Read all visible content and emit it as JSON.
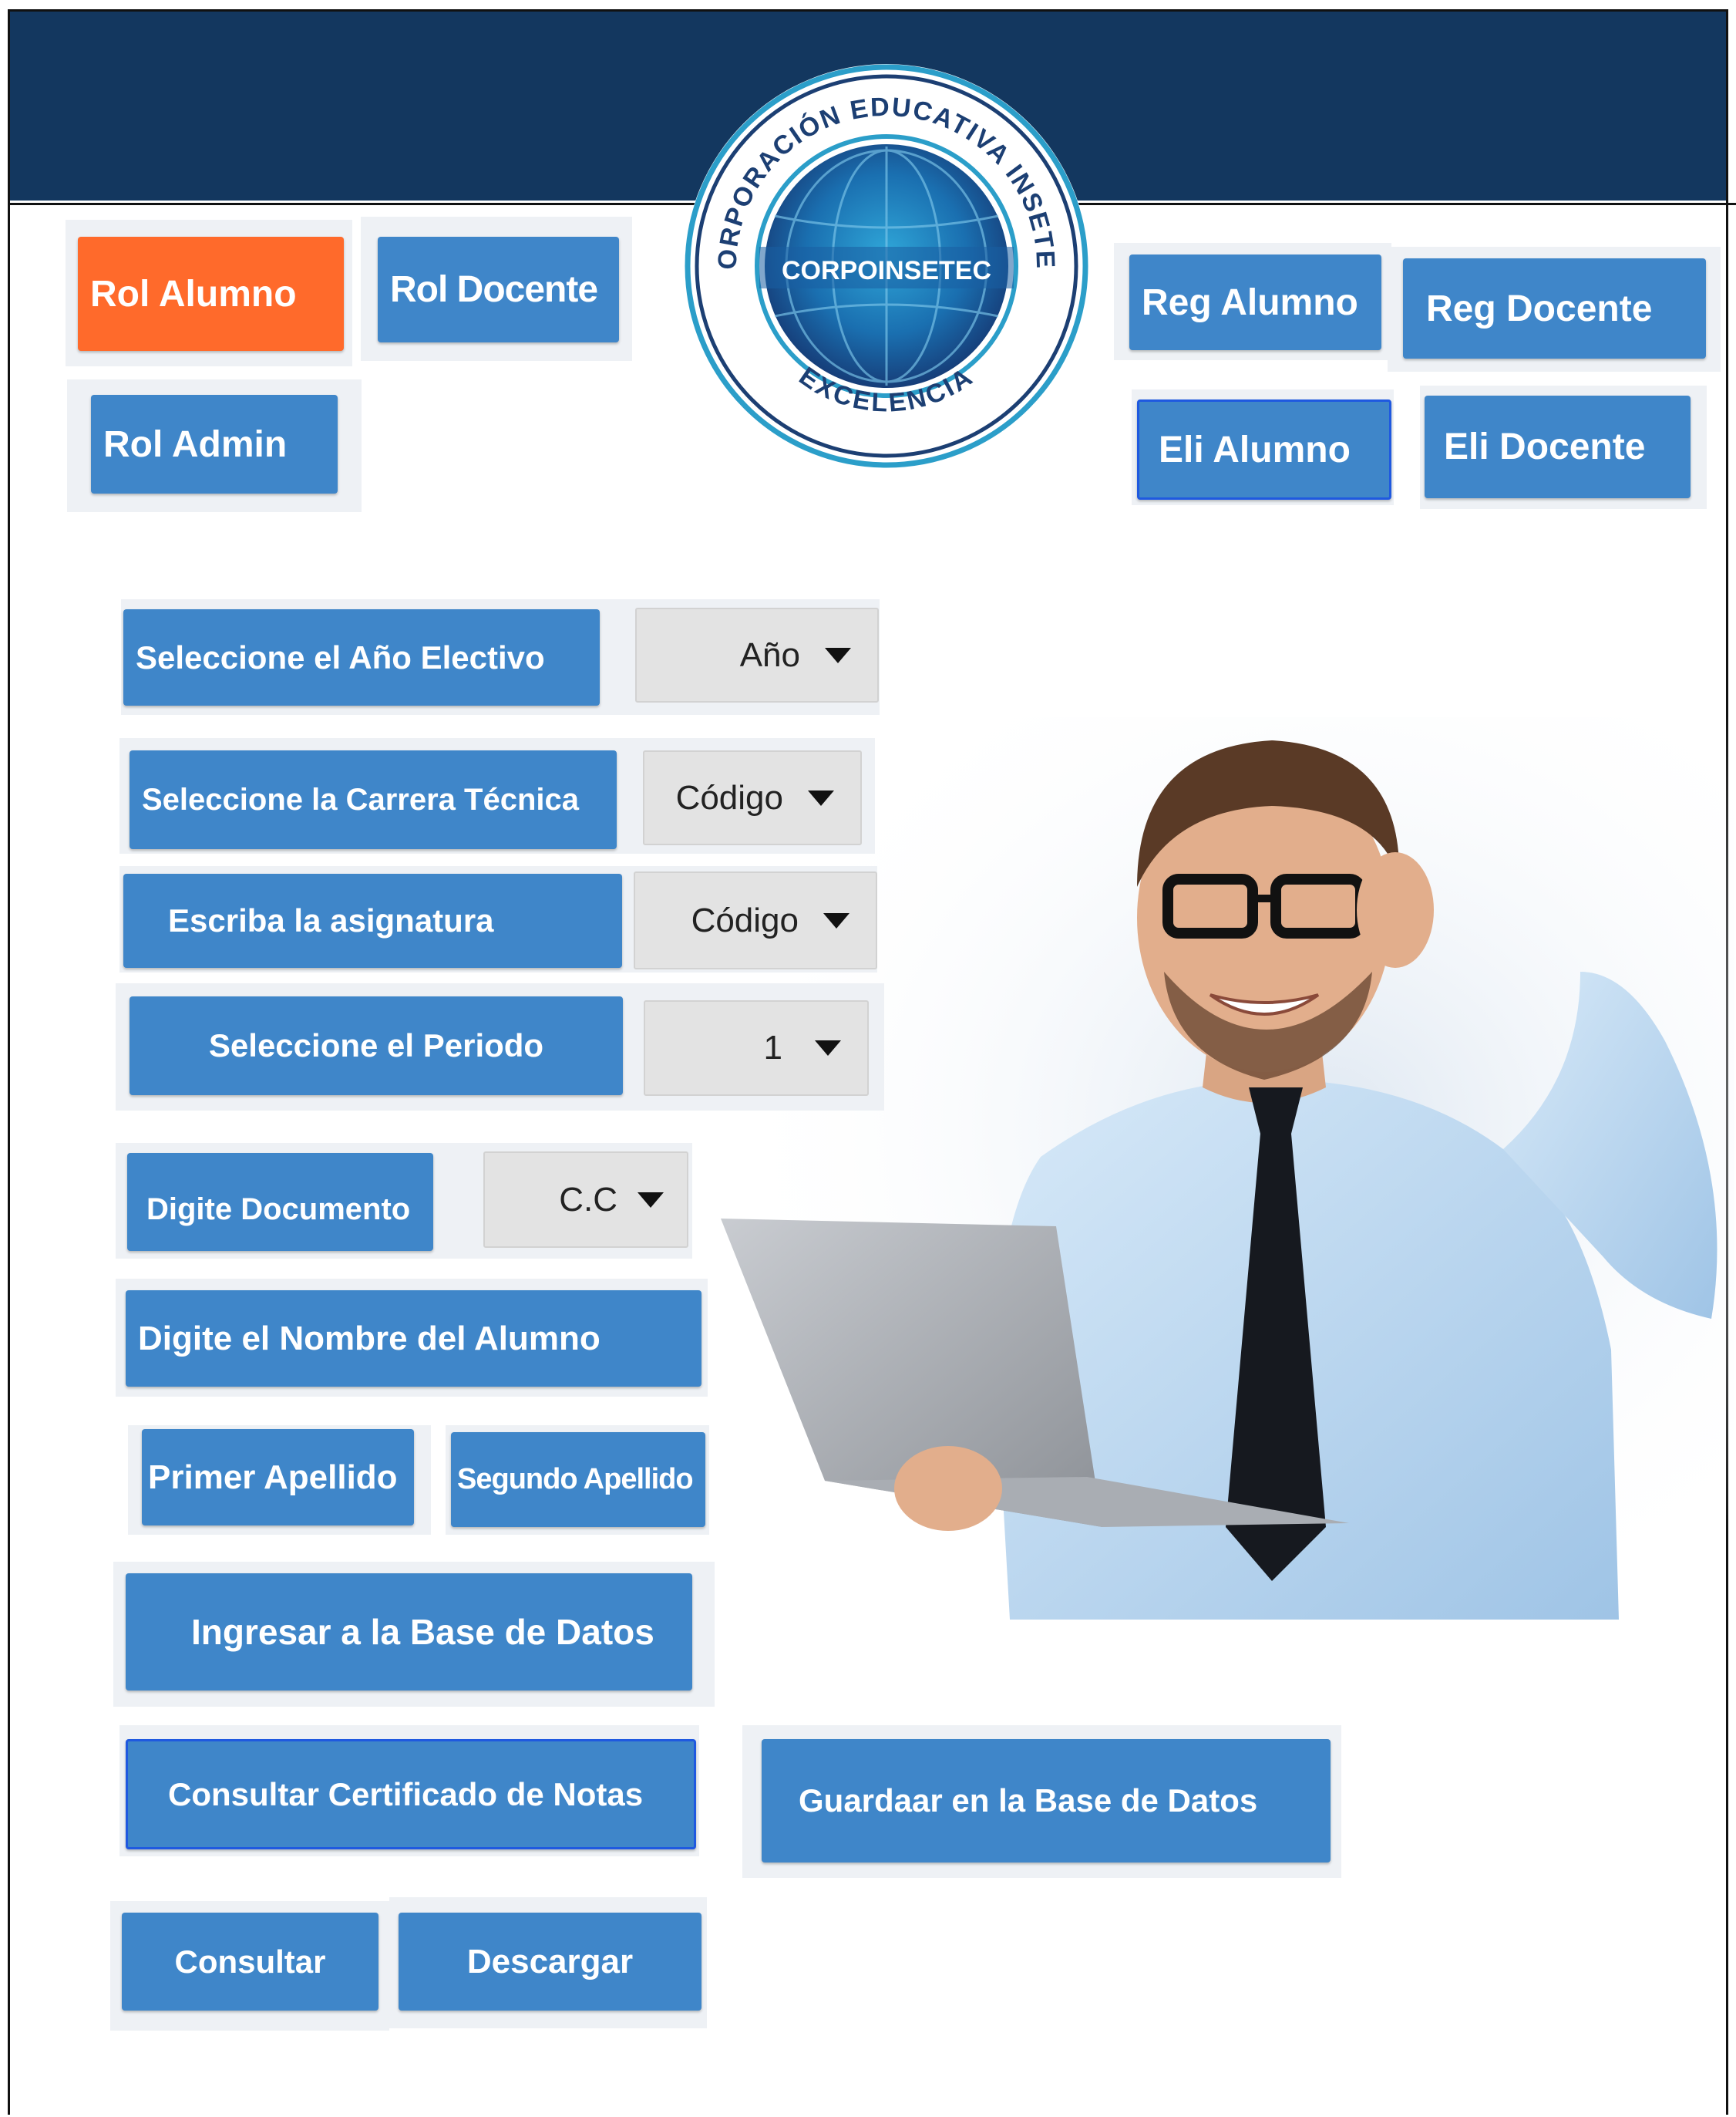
{
  "logo": {
    "arc_top": "CORPORACIÓN EDUCATIVA INSETEC",
    "center": "CORPOINSETEC",
    "arc_bottom": "EXCELENCIA"
  },
  "roles": {
    "alumno": "Rol  Alumno",
    "docente": "Rol Docente",
    "admin": "Rol Admin"
  },
  "actions": {
    "reg_alumno": "Reg Alumno",
    "reg_docente": "Reg  Docente",
    "eli_alumno": "Eli  Alumno",
    "eli_docente": "Eli  Docente"
  },
  "form": {
    "year_label": "Seleccione el Año Electivo",
    "year_value": "Año",
    "career_label": "Seleccione la Carrera Técnica",
    "career_value": "Código",
    "subject_label": "Escriba la asignatura",
    "subject_value": "Código",
    "period_label": "Seleccione el Periodo",
    "period_value": "1",
    "document_label": "Digite Documento",
    "document_value": "C.C",
    "name_label": "Digite el Nombre del Alumno",
    "first_surname": "Primer Apellido",
    "second_surname": "Segundo Apellido"
  },
  "buttons": {
    "enter_db": "Ingresar a la Base de Datos",
    "certificate": "Consultar Certificado de Notas",
    "save_db": "Guardaar en la Base de Datos",
    "consult": "Consultar",
    "download": "Descargar"
  },
  "colors": {
    "header": "#13375f",
    "button": "#3f86c9",
    "active_role": "#ff6a2b",
    "focus_outline": "#1f59e0"
  }
}
